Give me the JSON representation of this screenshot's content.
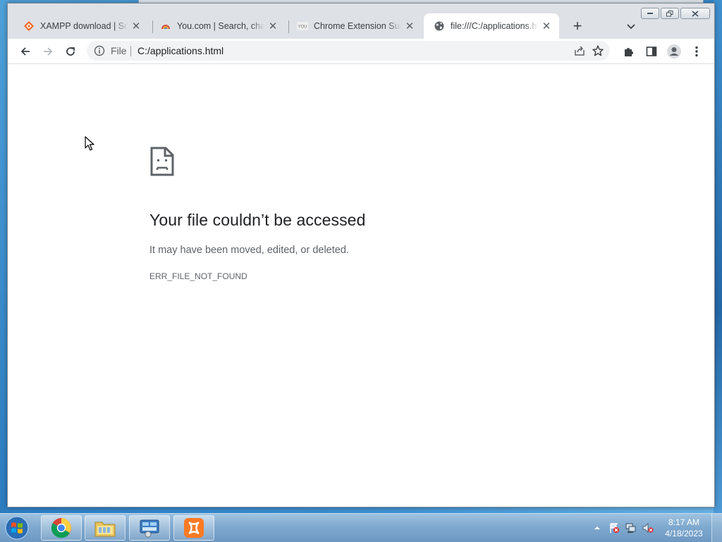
{
  "browser": {
    "tabs": [
      {
        "title": "XAMPP download | SourceForge",
        "favicon": "xampp-sourceforge-icon",
        "active": false
      },
      {
        "title": "You.com | Search, chat, and build",
        "favicon": "you-com-icon",
        "active": false
      },
      {
        "title": "Chrome Extension Successfully",
        "favicon": "you-logo-icon",
        "active": false
      },
      {
        "title": "file:///C:/applications.html",
        "favicon": "globe-icon",
        "active": true
      }
    ],
    "new_tab_label": "+",
    "omnibox": {
      "scheme_chip": "File",
      "url": "C:/applications.html"
    }
  },
  "error_page": {
    "icon": "sad-file-icon",
    "title": "Your file couldn’t be accessed",
    "description": "It may have been moved, edited, or deleted.",
    "code": "ERR_FILE_NOT_FOUND"
  },
  "taskbar": {
    "pinned": [
      "chrome-icon",
      "file-explorer-icon",
      "control-panel-icon",
      "xampp-icon"
    ],
    "clock": {
      "time": "8:17 AM",
      "date": "4/18/2023"
    }
  },
  "colors": {
    "accent": "#1a73e8",
    "xampp_orange": "#fb7a24",
    "taskbar": "#7fa9cf"
  }
}
